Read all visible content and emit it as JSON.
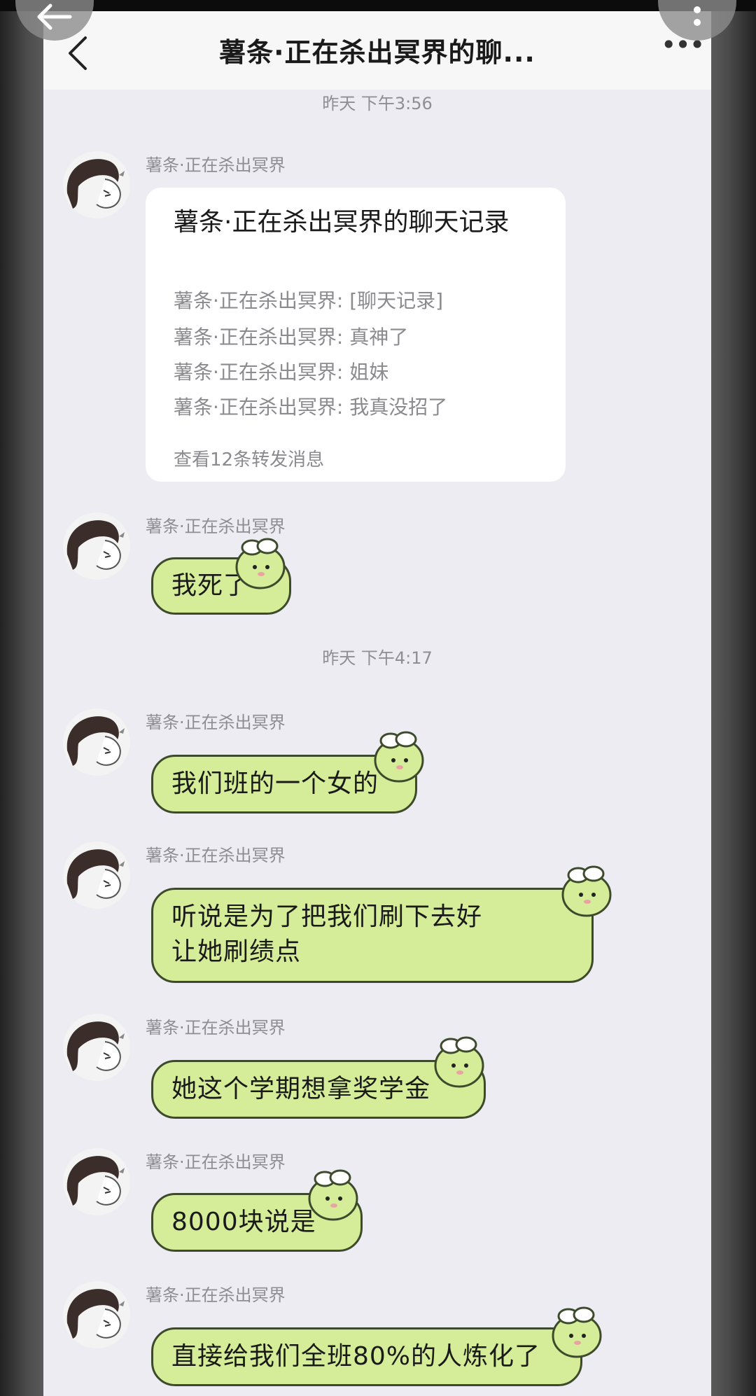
{
  "header": {
    "title": "薯条·正在杀出冥界的聊..."
  },
  "timestamps": [
    "昨天 下午3:56",
    "昨天 下午4:17"
  ],
  "sender": "薯条·正在杀出冥界",
  "forward_card": {
    "title": "薯条·正在杀出冥界的聊天记录",
    "lines": [
      "薯条·正在杀出冥界: [聊天记录]",
      "薯条·正在杀出冥界: 真神了",
      "薯条·正在杀出冥界: 姐妹",
      "薯条·正在杀出冥界: 我真没招了"
    ],
    "footer": "查看12条转发消息"
  },
  "messages": [
    {
      "text": "我死了"
    },
    {
      "text": "我们班的一个女的"
    },
    {
      "text": "听说是为了把我们刷下去好让她刷绩点"
    },
    {
      "text": "她这个学期想拿奖学金"
    },
    {
      "text": "8000块说是"
    },
    {
      "text": "直接给我们全班80%的人炼化了"
    }
  ],
  "colors": {
    "bubble": "#d5ec98",
    "chat_background": "#ececf2",
    "header_background": "#f7f7f7"
  },
  "icons": [
    "back-icon",
    "more-icon",
    "avatar",
    "sheep-sticker-icon"
  ]
}
